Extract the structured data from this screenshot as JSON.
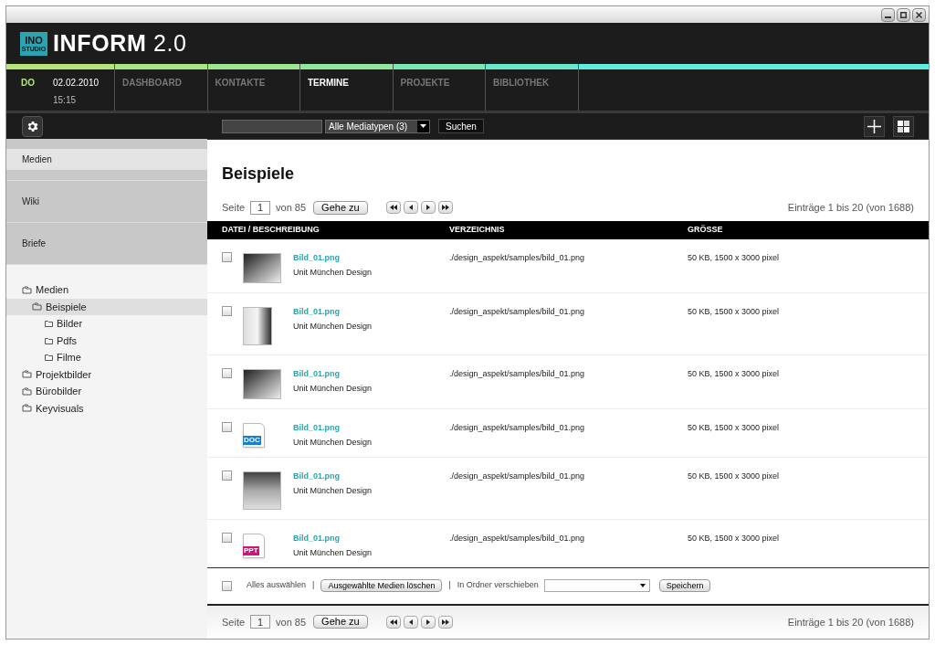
{
  "logo": {
    "badge_top": "INO",
    "badge_bottom": "STUDIO",
    "title": "INFORM",
    "version": "2.0"
  },
  "datetime": {
    "day": "DO",
    "date": "02.02.2010",
    "time": "15:15",
    "color": "#b5e37a"
  },
  "nav": [
    {
      "label": "DASHBOARD",
      "selected": false,
      "color": "#a8e583"
    },
    {
      "label": "KONTAKTE",
      "selected": false,
      "color": "#9be68e"
    },
    {
      "label": "TERMINE",
      "selected": true,
      "color": "#8ee79c"
    },
    {
      "label": "PROJEKTE",
      "selected": false,
      "color": "#7ae8b4"
    },
    {
      "label": "BIBLIOTHEK",
      "selected": false,
      "color": "#67e8cc"
    }
  ],
  "toolbar": {
    "media_filter": "Alle Mediatypen (3)",
    "search_button": "Suchen"
  },
  "sidebar": {
    "sections": [
      {
        "label": "Medien",
        "selected": true
      },
      {
        "label": "Wiki",
        "selected": false
      },
      {
        "label": "Briefe",
        "selected": false
      }
    ],
    "tree": [
      {
        "label": "Medien",
        "selected": false,
        "children": [
          {
            "label": "Beispiele",
            "selected": true,
            "children": [
              {
                "label": "Bilder",
                "selected": false
              },
              {
                "label": "Pdfs",
                "selected": false
              },
              {
                "label": "Filme",
                "selected": false
              }
            ]
          }
        ]
      },
      {
        "label": "Projektbilder",
        "selected": false
      },
      {
        "label": "Bürobilder",
        "selected": false
      },
      {
        "label": "Keyvisuals",
        "selected": false
      }
    ]
  },
  "main": {
    "title": "Beispiele",
    "pager_top": {
      "page_label": "Seite",
      "page": "1",
      "of": "von 85",
      "go": "Gehe zu",
      "entries": "Einträge 1 bis 20 (von 1688)"
    },
    "table": {
      "columns": [
        "DATEI / BESCHREIBUNG",
        "VERZEICHNIS",
        "GRÖSSE"
      ],
      "rows": [
        {
          "checked": false,
          "kind": "photo",
          "name": "Bild_01.png",
          "description": "Unit München Design",
          "path": "./design_aspekt/samples/bild_01.png",
          "size": "50 KB, 1500 x 3000 pixel"
        },
        {
          "checked": false,
          "kind": "photo-tall",
          "name": "Bild_01.png",
          "description": "Unit München Design",
          "path": "./design_aspekt/samples/bild_01.png",
          "size": "50 KB, 1500 x 3000 pixel"
        },
        {
          "checked": false,
          "kind": "photo",
          "name": "Bild_01.png",
          "description": "Unit München Design",
          "path": "./design_aspekt/samples/bild_01.png",
          "size": "50 KB, 1500 x 3000 pixel"
        },
        {
          "checked": false,
          "kind": "doc",
          "badge": "DOC",
          "name": "Bild_01.png",
          "description": "Unit München Design",
          "path": "./design_aspekt/samples/bild_01.png",
          "size": "50 KB, 1500 x 3000 pixel"
        },
        {
          "checked": false,
          "kind": "photo-square",
          "name": "Bild_01.png",
          "description": "Unit München Design",
          "path": "./design_aspekt/samples/bild_01.png",
          "size": "50 KB, 1500 x 3000 pixel"
        },
        {
          "checked": false,
          "kind": "ppt",
          "badge": "PPT",
          "name": "Bild_01.png",
          "description": "Unit München Design",
          "path": "./design_aspekt/samples/bild_01.png",
          "size": "50 KB, 1500 x 3000 pixel"
        }
      ]
    },
    "actions": {
      "select_all_checked": false,
      "select_all": "Alles auswählen",
      "separator_1": "|",
      "delete": "Ausgewählte Medien löschen",
      "separator_2": "|",
      "move_label": "In Ordner verschieben",
      "save": "Speichern"
    },
    "pager_bottom": {
      "page_label": "Seite",
      "page": "1",
      "of": "von 85",
      "go": "Gehe zu",
      "entries": "Einträge 1 bis 20 (von 1688)"
    }
  }
}
